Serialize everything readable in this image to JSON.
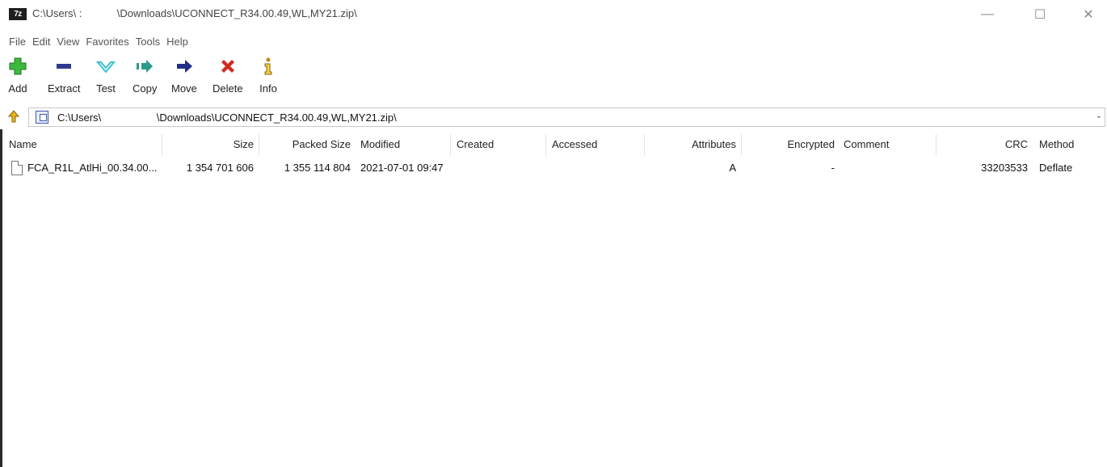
{
  "window": {
    "app_icon_text": "7z",
    "title": "C:\\Users\\ :            \\Downloads\\UCONNECT_R34.00.49,WL,MY21.zip\\",
    "minimize": "—",
    "maximize": "☐",
    "close": "✕"
  },
  "menu": [
    "File",
    "Edit",
    "View",
    "Favorites",
    "Tools",
    "Help"
  ],
  "toolbar": {
    "add": "Add",
    "extract": "Extract",
    "test": "Test",
    "copy": "Copy",
    "move": "Move",
    "delete": "Delete",
    "info": "Info"
  },
  "address": {
    "path": "C:\\Users\\                   \\Downloads\\UCONNECT_R34.00.49,WL,MY21.zip\\"
  },
  "columns": {
    "name": "Name",
    "size": "Size",
    "packed_size": "Packed Size",
    "modified": "Modified",
    "created": "Created",
    "accessed": "Accessed",
    "attributes": "Attributes",
    "encrypted": "Encrypted",
    "comment": "Comment",
    "crc": "CRC",
    "method": "Method"
  },
  "rows": [
    {
      "name": "FCA_R1L_AtlHi_00.34.00...",
      "size": "1 354 701 606",
      "packed_size": "1 355 114 804",
      "modified": "2021-07-01 09:47",
      "created": "",
      "accessed": "",
      "attributes": "A",
      "encrypted": "-",
      "comment": "",
      "crc": "33203533",
      "method": "Deflate"
    }
  ],
  "colors": {
    "add_green": "#3cb83c",
    "extract_blue": "#2d3a8c",
    "test_cyan": "#3cc1cf",
    "copy_teal": "#2b9a8a",
    "move_navy": "#1f2f86",
    "delete_red": "#d22a1e",
    "info_gold": "#b88a12"
  }
}
